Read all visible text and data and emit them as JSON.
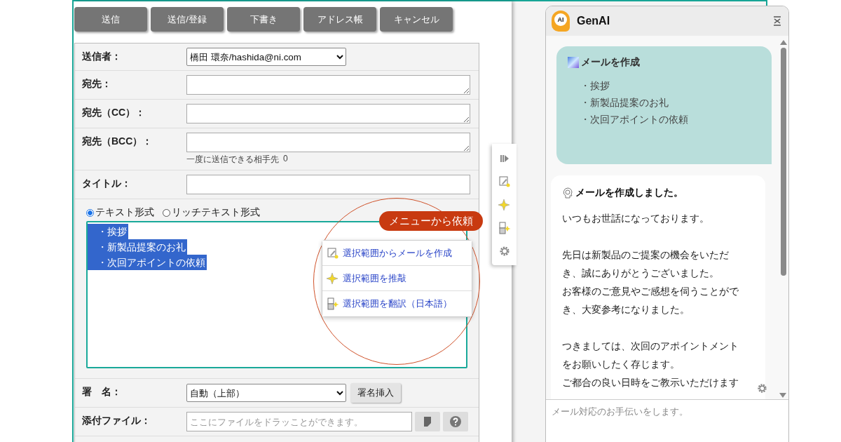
{
  "toolbar_buttons": [
    "送信",
    "送信/登録",
    "下書き",
    "アドレス帳",
    "キャンセル"
  ],
  "form_rows": [
    {
      "kind": "select",
      "label": "送信者：",
      "value": "橋田 環奈/hashida@ni.com"
    },
    {
      "kind": "textarea",
      "label": "宛先："
    },
    {
      "kind": "textarea",
      "label": "宛先（CC）："
    },
    {
      "kind": "textarea",
      "label": "宛先（BCC）：",
      "note": "一度に送信できる相手先",
      "note_count": "0"
    },
    {
      "kind": "input",
      "label": "タイトル："
    }
  ],
  "format_options": [
    {
      "label": "テキスト形式",
      "selected": true
    },
    {
      "label": "リッチテキスト形式",
      "selected": false
    }
  ],
  "body_lines": [
    {
      "text": "・挨拶",
      "selected": true
    },
    {
      "text": "・新製品提案のお礼",
      "selected": true
    },
    {
      "text": "・次回アポイントの依頼",
      "selected": true
    }
  ],
  "context_menu": [
    {
      "kind": "compose",
      "label": "選択範囲からメールを作成"
    },
    {
      "kind": "polish",
      "label": "選択範囲を推敲"
    },
    {
      "kind": "translate",
      "label": "選択範囲を翻訳（日本語）"
    }
  ],
  "callout": "メニューから依頼",
  "signature": {
    "label": "署　名：",
    "value": "自動（上部）",
    "button": "署名挿入"
  },
  "attachment": {
    "label": "添付ファイル：",
    "placeholder": "ここにファイルをドラッことができます。"
  },
  "genai": {
    "logo_text": "AI",
    "title": "GenAI",
    "request": {
      "title": "メールを作成",
      "items": [
        "・挨拶",
        "・新製品提案のお礼",
        "・次回アポイントの依頼"
      ]
    },
    "response": {
      "title": "メールを作成しました。",
      "paragraphs": [
        [
          "いつもお世話になっております。"
        ],
        [
          "先日は新製品のご提案の機会をいただ",
          "き、誠にありがとうございました。",
          "お客様のご意見やご感想を伺うことがで",
          "き、大変参考になりました。"
        ],
        [
          "つきましては、次回のアポイントメント",
          "をお願いしたく存じます。",
          "ご都合の良い日時をご教示いただけます"
        ]
      ]
    },
    "input": {
      "placeholder": "メール対応のお手伝いをします。"
    }
  }
}
